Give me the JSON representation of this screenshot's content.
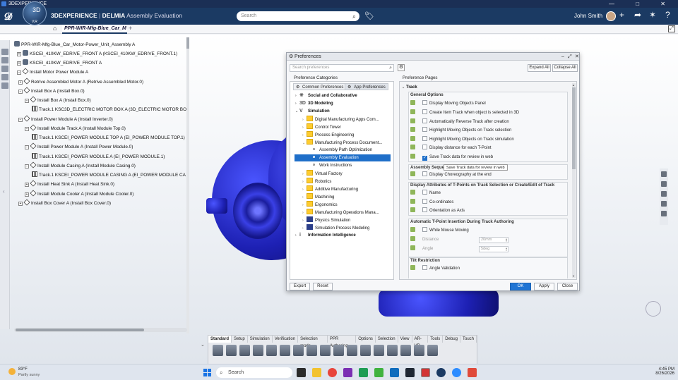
{
  "window": {
    "title": "3DEXPERIENCE",
    "controls": [
      "—",
      "□",
      "✕"
    ]
  },
  "header": {
    "brand_prefix": "3DEXPERIENCE",
    "brand_separator": "|",
    "brand_app": "DELMIA",
    "brand_sub": "Assembly Evaluation",
    "compass_labels": {
      "top": "3D",
      "left": "",
      "bottom": "V,R"
    },
    "search_placeholder": "Search",
    "user": "John Smith"
  },
  "tab": {
    "label": "PPR-WIR-Mfg-Blue_Car_M",
    "add": "+"
  },
  "tree": {
    "nodes": [
      {
        "label": "PPR-WIR-Mfg-Blue_Car_Motor-Power_Unit_Assembly A"
      },
      {
        "label": "KSCEI_410KW_EDRIVE_FRONT A (KSCEI_410KW_EDRIVE_FRONT.1)"
      },
      {
        "label": "KSCEI_410KW_EDRIVE_FRONT A"
      },
      {
        "label": "Install Motor Power Module A"
      },
      {
        "label": "Retrive Assembled Motor A (Retrive Assembled Motor.0)"
      },
      {
        "label": "Install Box A (Install Box.0)"
      },
      {
        "label": "Install Box A (Install Box.0)"
      },
      {
        "label": "Track.1  KSC3D_ELECTRIC MOTOR BOX A (3D_ELECTRIC MOTOR BO"
      },
      {
        "label": "Install Power Module A (Install Inverter.0)"
      },
      {
        "label": "Install Module Track A (Install Module Top.0)"
      },
      {
        "label": "Track.1  KSCEI_POWER MODULE TOP A (EI_POWER MODULE TOP.1)"
      },
      {
        "label": "Install Power Module A (Install Power Module.0)"
      },
      {
        "label": "Track.1  KSCEI_POWER MODULE A (EI_POWER MODULE.1)"
      },
      {
        "label": "Install Module Casing A (Install Module Casing.0)"
      },
      {
        "label": "Track.1  KSCEI_POWER MODULE CASING A (EI_POWER MODULE CA"
      },
      {
        "label": "Install Heat Sink A (Install Heat Sink.0)"
      },
      {
        "label": "Install Module Cooler A (Install Module Cooler.0)"
      },
      {
        "label": "Install Box Cover A (Install Box Cover.0)"
      }
    ]
  },
  "action_bar": {
    "tabs": [
      "Standard",
      "Setup",
      "Simulation",
      "Verification",
      "Selection mode",
      "PPR Authoring",
      "Options",
      "Selection",
      "View",
      "AR-VR",
      "Tools",
      "Debug",
      "Touch"
    ],
    "selected_tab": "Standard"
  },
  "dialog": {
    "title": "Preferences",
    "categories_header": "Preference Categories",
    "search_placeholder": "Search preferences",
    "tab_common": "Common Preferences",
    "tab_app": "App Preferences",
    "categories": [
      {
        "label": "Social and Collaborative"
      },
      {
        "label": "3D Modeling"
      },
      {
        "label": "Simulation"
      },
      {
        "label": "Digital Manufacturing Apps Com..."
      },
      {
        "label": "Control Tower"
      },
      {
        "label": "Process Engineering"
      },
      {
        "label": "Manufacturing Process Document..."
      },
      {
        "label": "Assembly Path Optimization"
      },
      {
        "label": "Assembly Evaluation"
      },
      {
        "label": "Work Instructions"
      },
      {
        "label": "Virtual Factory"
      },
      {
        "label": "Robotics"
      },
      {
        "label": "Additive Manufacturing"
      },
      {
        "label": "Machining"
      },
      {
        "label": "Ergonomics"
      },
      {
        "label": "Manufacturing Operations Mana..."
      },
      {
        "label": "Physics Simulation"
      },
      {
        "label": "Simulation Process Modeling"
      },
      {
        "label": "Information Intelligence"
      }
    ],
    "pages_header": "Preference Pages",
    "expand_all": "Expand All",
    "collapse_all": "Collapse All",
    "section": "Track",
    "general_options": {
      "title": "General Options",
      "items": [
        {
          "label": "Display Moving Objects Panel",
          "checked": false
        },
        {
          "label": "Create Item Track when object is selected in 3D",
          "checked": false
        },
        {
          "label": "Automatically Reverse Track after creation",
          "checked": false
        },
        {
          "label": "Highlight Moving Objects on Track selection",
          "checked": false
        },
        {
          "label": "Highlight Moving Objects on Track simulation",
          "checked": false
        },
        {
          "label": "Display distance for each T-Point",
          "checked": false
        },
        {
          "label": "Save Track data for review in web",
          "checked": true
        }
      ]
    },
    "tooltip": "Save Track data for review in web",
    "assembly_sequence": {
      "title": "Assembly Sequence",
      "items": [
        {
          "label": "Display Choreography at the end",
          "checked": false
        }
      ]
    },
    "display_attributes": {
      "title": "Display Attributes of T-Points on Track Selection or Create/Edit of Track",
      "items": [
        {
          "label": "Name",
          "checked": false
        },
        {
          "label": "Co-ordinates",
          "checked": false
        },
        {
          "label": "Orientation as Axis",
          "checked": false
        }
      ]
    },
    "auto_insertion": {
      "title": "Automatic T-Point Insertion During Track Authoring",
      "while_moving": "While Mouse Moving",
      "distance_label": "Distance",
      "distance_value": "20mm",
      "angle_label": "Angle",
      "angle_value": "5deg"
    },
    "tilt": {
      "title": "Tilt Restriction",
      "items": [
        {
          "label": "Angle Validation",
          "checked": false
        }
      ]
    },
    "buttons": {
      "export": "Export",
      "reset": "Reset",
      "ok": "OK",
      "apply": "Apply",
      "close": "Close"
    }
  },
  "taskbar": {
    "weather_temp": "83°F",
    "weather_cond": "Partly sunny",
    "search": "Search",
    "time": "4:45 PM",
    "date": "8/26/2026"
  },
  "colors": {
    "topbar": "#1b3a63",
    "accent": "#1f6fc9",
    "model": "#2326d1",
    "folder": "#ffcc2e"
  }
}
